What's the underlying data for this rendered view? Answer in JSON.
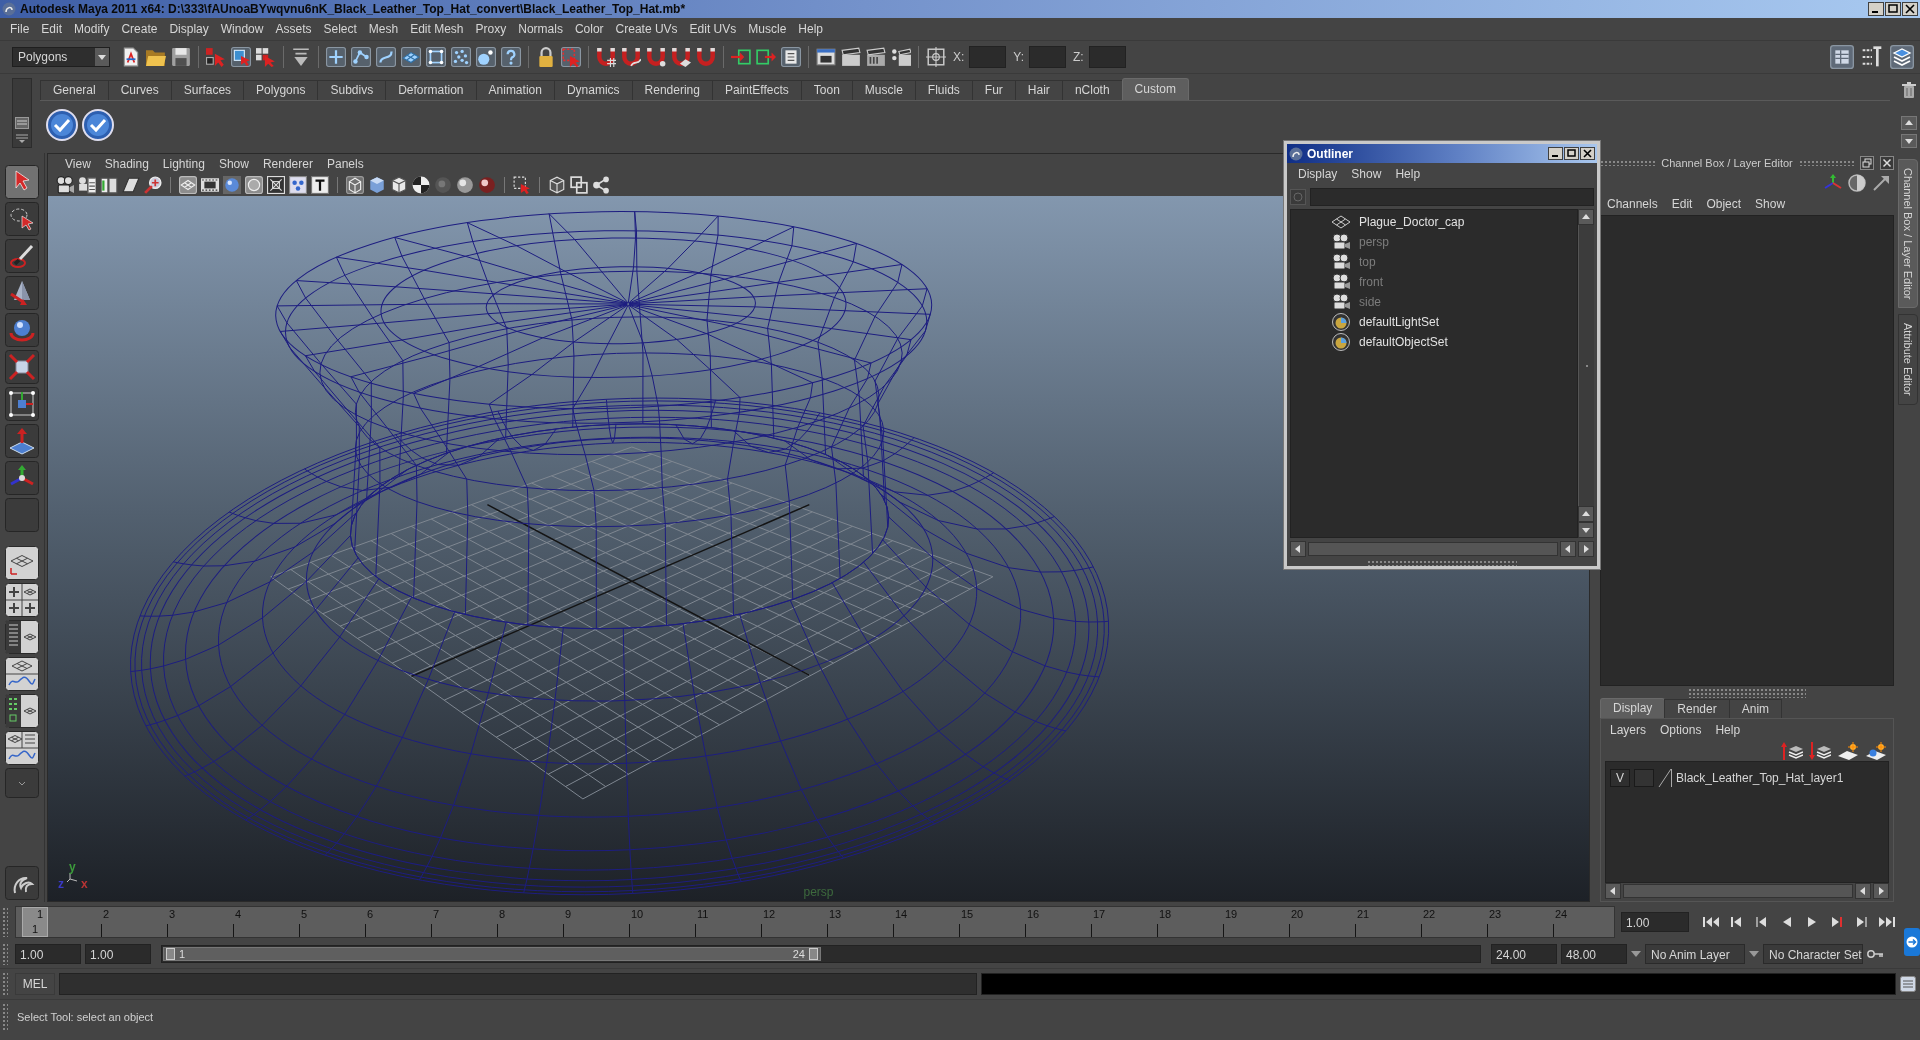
{
  "window": {
    "title": "Autodesk Maya 2011 x64: D:\\333\\fAUnoaBYwqvnu6nK_Black_Leather_Top_Hat_convert\\Black_Leather_Top_Hat.mb*"
  },
  "menu_bar": [
    "File",
    "Edit",
    "Modify",
    "Create",
    "Display",
    "Window",
    "Assets",
    "Select",
    "Mesh",
    "Edit Mesh",
    "Proxy",
    "Normals",
    "Color",
    "Create UVs",
    "Edit UVs",
    "Muscle",
    "Help"
  ],
  "status_line": {
    "menu_set": "Polygons",
    "coordinate_fields": [
      {
        "label": "X:"
      },
      {
        "label": "Y:"
      },
      {
        "label": "Z:"
      }
    ]
  },
  "shelf": {
    "tabs": [
      {
        "label": "General",
        "selected": false
      },
      {
        "label": "Curves",
        "selected": false
      },
      {
        "label": "Surfaces",
        "selected": false
      },
      {
        "label": "Polygons",
        "selected": false
      },
      {
        "label": "Subdivs",
        "selected": false
      },
      {
        "label": "Deformation",
        "selected": false
      },
      {
        "label": "Animation",
        "selected": false
      },
      {
        "label": "Dynamics",
        "selected": false
      },
      {
        "label": "Rendering",
        "selected": false
      },
      {
        "label": "PaintEffects",
        "selected": false
      },
      {
        "label": "Toon",
        "selected": false
      },
      {
        "label": "Muscle",
        "selected": false
      },
      {
        "label": "Fluids",
        "selected": false
      },
      {
        "label": "Fur",
        "selected": false
      },
      {
        "label": "Hair",
        "selected": false
      },
      {
        "label": "nCloth",
        "selected": false
      },
      {
        "label": "Custom",
        "selected": true
      }
    ]
  },
  "toolbox": {
    "tools": [
      {
        "kind": "select",
        "selected": true
      },
      {
        "kind": "lasso",
        "selected": false
      },
      {
        "kind": "paint",
        "selected": false
      },
      {
        "kind": "move",
        "selected": false
      },
      {
        "kind": "rotate",
        "selected": false
      },
      {
        "kind": "scale",
        "selected": false
      },
      {
        "kind": "manipulator",
        "selected": false
      },
      {
        "kind": "soft",
        "selected": false
      },
      {
        "kind": "show",
        "selected": false
      },
      {
        "kind": "empty",
        "selected": false
      }
    ]
  },
  "viewport": {
    "menus": [
      "View",
      "Shading",
      "Lighting",
      "Show",
      "Renderer",
      "Panels"
    ],
    "camera": "persp",
    "axes": [
      {
        "label": "y",
        "color": "#3c9c3c"
      },
      {
        "label": "z",
        "color": "#3a3ac8"
      },
      {
        "label": "x",
        "color": "#b83434"
      }
    ]
  },
  "outliner": {
    "title": "Outliner",
    "menus": [
      "Display",
      "Show",
      "Help"
    ],
    "items": [
      {
        "label": "Plague_Doctor_cap",
        "kind": "mesh",
        "dimmed": false
      },
      {
        "label": "persp",
        "kind": "camera",
        "dimmed": true
      },
      {
        "label": "top",
        "kind": "camera",
        "dimmed": true
      },
      {
        "label": "front",
        "kind": "camera",
        "dimmed": true
      },
      {
        "label": "side",
        "kind": "camera",
        "dimmed": true
      },
      {
        "label": "defaultLightSet",
        "kind": "set",
        "dimmed": false
      },
      {
        "label": "defaultObjectSet",
        "kind": "set",
        "dimmed": false
      }
    ]
  },
  "channel_box": {
    "title": "Channel Box / Layer Editor",
    "menus": [
      "Channels",
      "Edit",
      "Object",
      "Show"
    ]
  },
  "side_tabs": [
    {
      "label": "Channel Box / Layer Editor",
      "selected": true
    },
    {
      "label": "Attribute Editor",
      "selected": false
    }
  ],
  "layer_editor": {
    "tabs": [
      {
        "label": "Display",
        "selected": true
      },
      {
        "label": "Render",
        "selected": false
      },
      {
        "label": "Anim",
        "selected": false
      }
    ],
    "menus": [
      "Layers",
      "Options",
      "Help"
    ],
    "layers": [
      {
        "visibility": "V",
        "name": "Black_Leather_Top_Hat_layer1"
      }
    ]
  },
  "time_slider": {
    "frames": [
      "1",
      "2",
      "3",
      "4",
      "5",
      "6",
      "7",
      "8",
      "9",
      "10",
      "11",
      "12",
      "13",
      "14",
      "15",
      "16",
      "17",
      "18",
      "19",
      "20",
      "21",
      "22",
      "23",
      "24"
    ],
    "current_frame": "1",
    "level": 0,
    "current_time": "1.00"
  },
  "range_slider": {
    "start_time": "1.00",
    "playback_start": "1.00",
    "range_start": "1",
    "range_end": "24",
    "level": 0.5,
    "playback_end": "24.00",
    "end_time": "48.00",
    "anim_layer": "No Anim Layer",
    "character_set": "No Character Set"
  },
  "command_line": {
    "language": "MEL"
  },
  "help_line": "Select Tool: select an object"
}
